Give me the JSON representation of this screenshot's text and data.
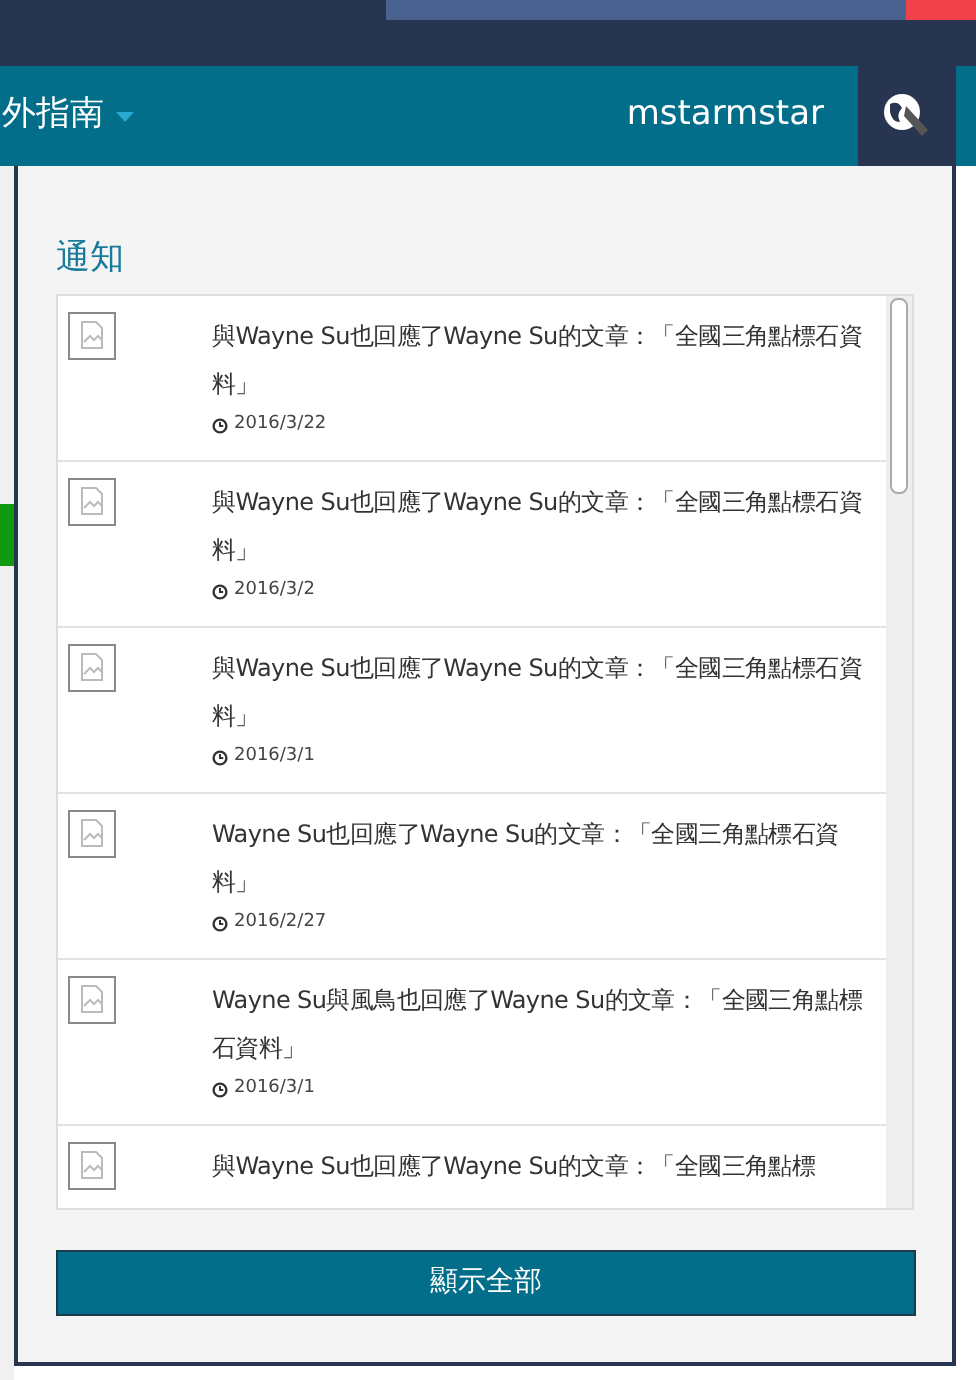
{
  "navbar": {
    "menu_label": "外指南",
    "username": "mstarmstar"
  },
  "notifications": {
    "title": "通知",
    "items": [
      {
        "text": "與Wayne Su也回應了Wayne Su的文章：「全國三角點標石資料」",
        "date": "2016/3/22"
      },
      {
        "text": "與Wayne Su也回應了Wayne Su的文章：「全國三角點標石資料」",
        "date": "2016/3/2"
      },
      {
        "text": "與Wayne Su也回應了Wayne Su的文章：「全國三角點標石資料」",
        "date": "2016/3/1"
      },
      {
        "text": "Wayne Su也回應了Wayne Su的文章：「全國三角點標石資料」",
        "date": "2016/2/27"
      },
      {
        "text": "Wayne Su與風鳥也回應了Wayne Su的文章：「全國三角點標石資料」",
        "date": "2016/3/1"
      },
      {
        "text": "與Wayne Su也回應了Wayne Su的文章：「全國三角點標"
      }
    ],
    "show_all_button": "顯示全部"
  }
}
